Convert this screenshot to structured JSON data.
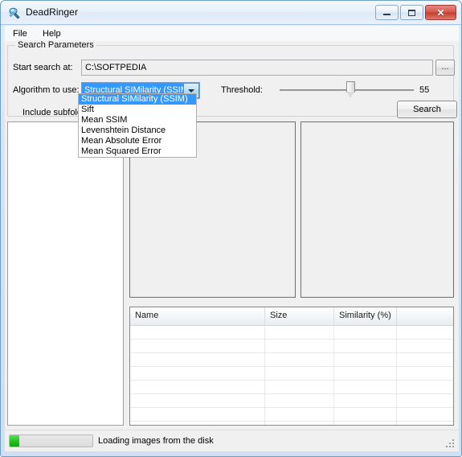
{
  "window": {
    "title": "DeadRinger",
    "icon": "app-icon",
    "controls": {
      "minimize": "minimize-icon",
      "maximize": "maximize-icon",
      "close": "✕"
    }
  },
  "menu": {
    "items": [
      {
        "label": "File"
      },
      {
        "label": "Help"
      }
    ]
  },
  "search_parameters": {
    "legend": "Search Parameters",
    "path_label": "Start search at:",
    "path_value": "C:\\SOFTPEDIA",
    "browse_label": "...",
    "algorithm_label": "Algorithm to use:",
    "algorithm_selected": "Structural SIMilarity (SSIM)",
    "algorithm_options": [
      "Structural SIMilarity (SSIM)",
      "Sift",
      "Mean SSIM",
      "Levenshtein Distance",
      "Mean Absolute Error",
      "Mean Squared Error"
    ],
    "threshold_label": "Threshold:",
    "threshold_value": "55",
    "subfolders_label": "Include subfolders",
    "search_button": "Search"
  },
  "results": {
    "columns": [
      "Name",
      "Size",
      "Similarity (%)",
      ""
    ],
    "rows": []
  },
  "status": {
    "message": "Loading images from the disk",
    "progress_percent": 12,
    "progress_color": "#1fc21f"
  }
}
